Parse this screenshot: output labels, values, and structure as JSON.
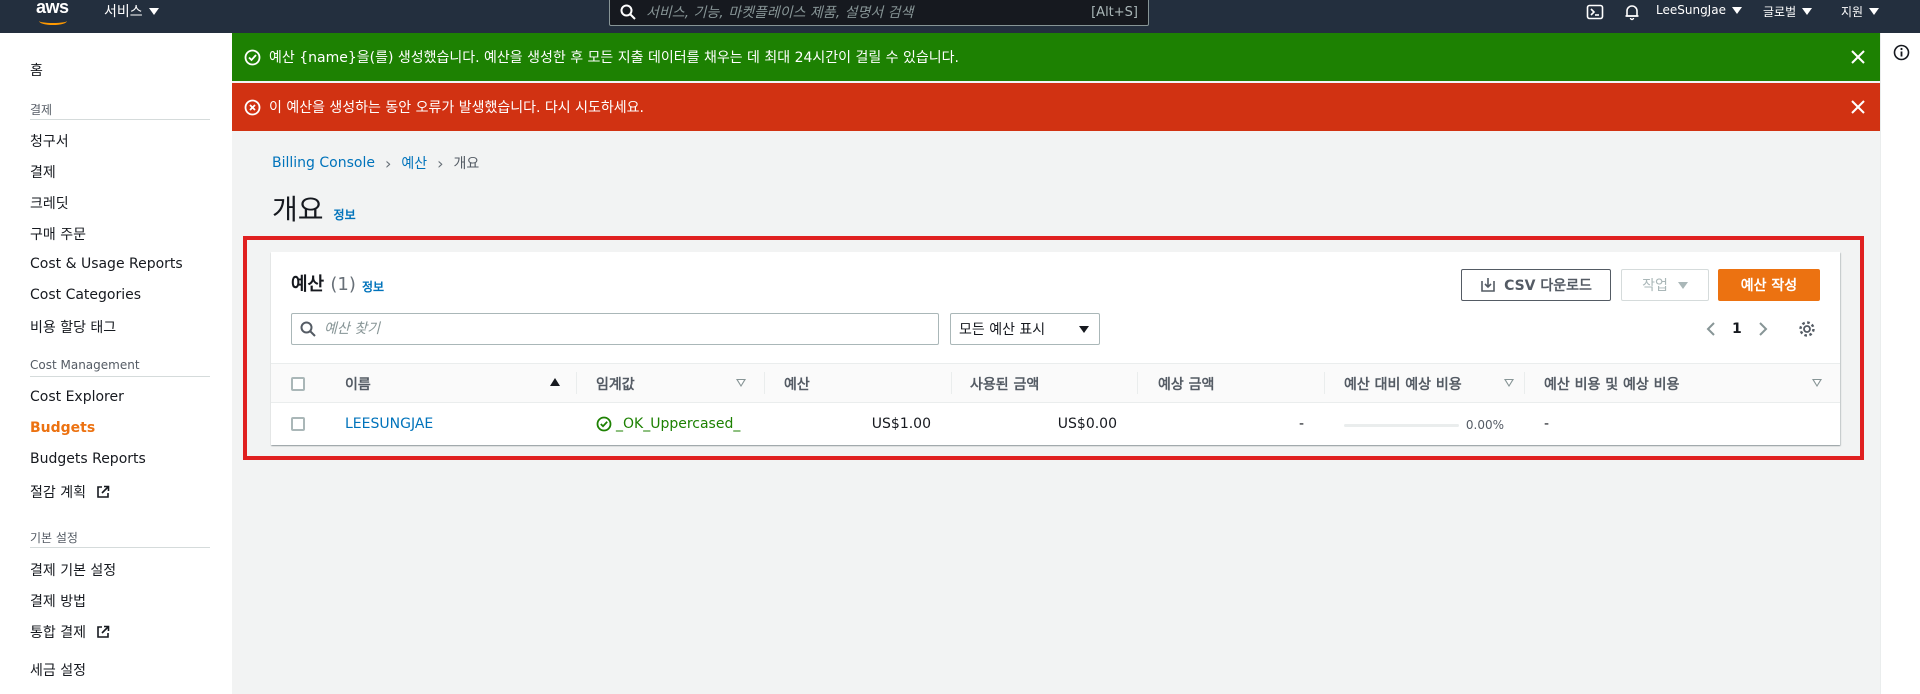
{
  "nav": {
    "logo": "aws",
    "services_label": "서비스",
    "search_placeholder": "서비스, 기능, 마켓플레이스 제품, 설명서 검색",
    "search_shortcut": "[Alt+S]",
    "user": "LeeSungJae",
    "region": "글로벌",
    "support": "지원"
  },
  "sidebar": {
    "home": "홈",
    "section_billing": "결제",
    "billing_items": [
      "청구서",
      "결제",
      "크레딧",
      "구매 주문",
      "Cost & Usage Reports",
      "Cost Categories",
      "비용 할당 태그"
    ],
    "section_cost_mgmt": "Cost Management",
    "cost_items": [
      "Cost Explorer",
      "Budgets",
      "Budgets Reports",
      "절감 계획"
    ],
    "section_prefs": "기본 설정",
    "pref_items": [
      "결제 기본 설정",
      "결제 방법",
      "통합 결제",
      "세금 설정"
    ]
  },
  "flash": {
    "success": "예산 {name}을(를) 생성했습니다. 예산을 생성한 후 모든 지출 데이터를 채우는 데 최대 24시간이 걸릴 수 있습니다.",
    "error": "이 예산을 생성하는 동안 오류가 발생했습니다. 다시 시도하세요."
  },
  "breadcrumb": [
    "Billing Console",
    "예산",
    "개요"
  ],
  "page": {
    "title": "개요",
    "info": "정보"
  },
  "budgets": {
    "title": "예산",
    "count": "(1)",
    "info": "정보",
    "csv_label": "CSV 다운로드",
    "action_label": "작업",
    "create_label": "예산 작성",
    "search_placeholder": "예산 찾기",
    "filter_value": "모든 예산 표시",
    "page_number": "1",
    "columns": [
      "이름",
      "임계값",
      "예산",
      "사용된 금액",
      "예상 금액",
      "예산 대비 예상 비용",
      "예산 비용 및 예상 비용"
    ],
    "rows": [
      {
        "name": "LEESUNGJAE",
        "threshold": "_OK_Uppercased_",
        "budget": "US$1.00",
        "used": "US$0.00",
        "forecast": "-",
        "forecast_vs_budget": "0.00%",
        "forecast_vs_budget_fraction": 0,
        "cost_and_forecast": "-"
      }
    ]
  },
  "colors": {
    "accent": "#ec7211",
    "link": "#0073bb",
    "success": "#1d8102",
    "error": "#d13212",
    "highlight": "#e02020"
  }
}
